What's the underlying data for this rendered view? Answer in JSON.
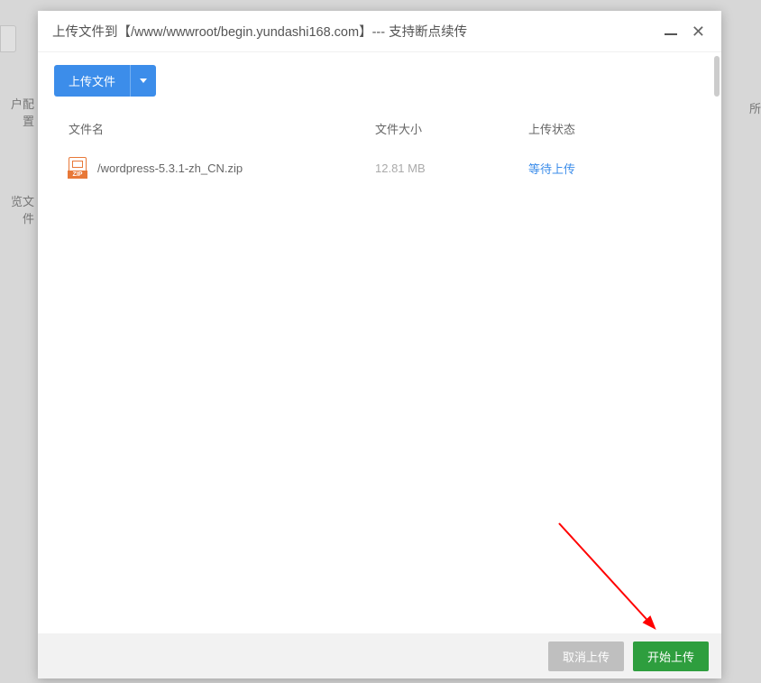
{
  "dialog": {
    "title": "上传文件到【/www/wwwroot/begin.yundashi168.com】--- 支持断点续传",
    "upload_button_label": "上传文件"
  },
  "table": {
    "headers": {
      "name": "文件名",
      "size": "文件大小",
      "status": "上传状态"
    },
    "rows": [
      {
        "icon_label": "ZIP",
        "filename": "/wordpress-5.3.1-zh_CN.zip",
        "size": "12.81 MB",
        "status": "等待上传"
      }
    ]
  },
  "footer": {
    "cancel_label": "取消上传",
    "start_label": "开始上传"
  },
  "background": {
    "sidebar_item1": "户配置",
    "sidebar_item2": "览文件",
    "right_text": "所"
  }
}
